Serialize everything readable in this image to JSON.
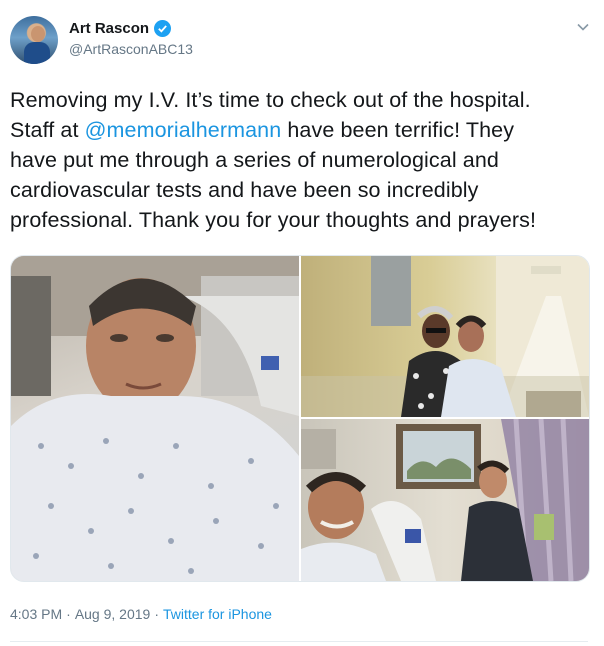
{
  "user": {
    "display_name": "Art Rascon",
    "handle": "@ArtRasconABC13",
    "verified": true
  },
  "icons": {
    "verified": "verified-badge-icon",
    "menu": "chevron-down-icon"
  },
  "tweet": {
    "lines": [
      {
        "parts": [
          {
            "text": "Removing my I.V.  It’s time to check out of the hospital."
          }
        ]
      },
      {
        "parts": [
          {
            "text": "Staff at "
          },
          {
            "text": "@memorialhermann",
            "mention": true
          },
          {
            "text": "  have been terrific!  They"
          }
        ]
      },
      {
        "parts": [
          {
            "text": "have put me through a series of numerological and"
          }
        ]
      },
      {
        "parts": [
          {
            "text": "cardiovascular tests and have been so incredibly"
          }
        ]
      },
      {
        "parts": [
          {
            "text": "professional.  Thank you for your thoughts and prayers!"
          }
        ]
      }
    ]
  },
  "media": {
    "photos": [
      {
        "name": "selfie-hospital-bed"
      },
      {
        "name": "photo-with-visitor-hallway"
      },
      {
        "name": "photo-with-visitor-room"
      }
    ]
  },
  "meta": {
    "time": "4:03 PM",
    "separator1": "·",
    "date": "Aug 9, 2019",
    "separator2": "·",
    "source": "Twitter for iPhone"
  },
  "colors": {
    "link": "#1b95e0",
    "verified": "#1da1f2",
    "secondary_text": "#657786"
  }
}
